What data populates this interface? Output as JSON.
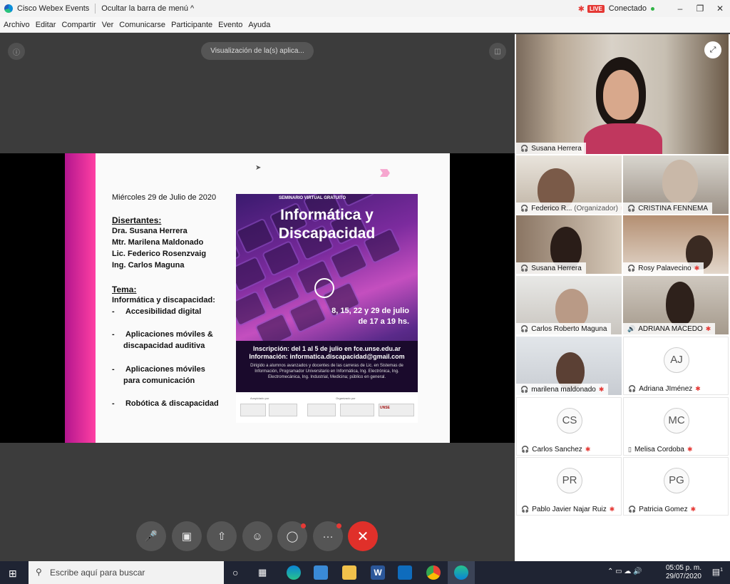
{
  "window": {
    "app_title": "Cisco Webex Events",
    "hide_menu_label": "Ocultar la barra de menú",
    "live_badge": "LIVE",
    "connection_status": "Conectado"
  },
  "menu": [
    "Archivo",
    "Editar",
    "Compartir",
    "Ver",
    "Comunicarse",
    "Participante",
    "Evento",
    "Ayuda"
  ],
  "stage": {
    "share_view_label": "Visualización de la(s) aplica..."
  },
  "slide": {
    "date": "Miércoles 29 de Julio de 2020",
    "speakers_heading": "Disertantes:",
    "speakers": [
      "Dra. Susana Herrera",
      "Mtr. Marilena Maldonado",
      "Lic. Federico Rosenzvaig",
      "Ing. Carlos Maguna"
    ],
    "topic_heading": "Tema:",
    "topic": "Informática y discapacidad:",
    "bullets": [
      [
        "Accesibilidad digital"
      ],
      [
        "Aplicaciones móviles &",
        "discapacidad auditiva"
      ],
      [
        "Aplicaciones móviles",
        "para comunicación"
      ],
      [
        "Robótica & discapacidad"
      ]
    ],
    "poster": {
      "tag": "SEMINARIO VIRTUAL GRATUITO",
      "title_line1": "Informática y",
      "title_line2": "Discapacidad",
      "dates_line1": "8, 15, 22 y 29 de julio",
      "dates_line2": "de 17 a 19 hs.",
      "inscripcion": "Inscripción: del 1 al 5 de julio en fce.unse.edu.ar",
      "informacion": "Información: informatica.discapacidad@gmail.com",
      "small_text": "Dirigido a alumnos avanzados y docentes de las carreras de Lic. en Sistemas de Información, Programador Universitario en Informática, Ing. Electrónica, Ing. Electromecánica, Ing. Industrial, Medicina; público en general.",
      "auspiciado": "Auspiciado por",
      "organizado": "Organizado por",
      "logo_unse": "UNSE"
    }
  },
  "participants": {
    "active_speaker": "Susana Herrera",
    "tiles": [
      {
        "name": "Federico R...",
        "extra": "(Organizador)"
      },
      {
        "name": "CRISTINA FENNEMA",
        "extra": ""
      },
      {
        "name": "Susana Herrera",
        "extra": ""
      },
      {
        "name": "Rosy Palavecino",
        "extra": ""
      },
      {
        "name": "Carlos Roberto Maguna",
        "extra": ""
      },
      {
        "name": "ADRIANA MACEDO",
        "extra": ""
      },
      {
        "name": "marilena maldonado",
        "extra": ""
      },
      {
        "name": "Adriana JIménez",
        "initials": "AJ"
      },
      {
        "name": "Carlos Sanchez",
        "initials": "CS"
      },
      {
        "name": "Melisa Cordoba",
        "initials": "MC"
      },
      {
        "name": "Pablo Javier Najar Ruiz",
        "initials": "PR"
      },
      {
        "name": "Patricia Gomez",
        "initials": "PG"
      }
    ]
  },
  "taskbar": {
    "search_placeholder": "Escribe aquí para buscar",
    "time": "05:05 p. m.",
    "date": "29/07/2020",
    "notif_count": "1"
  }
}
